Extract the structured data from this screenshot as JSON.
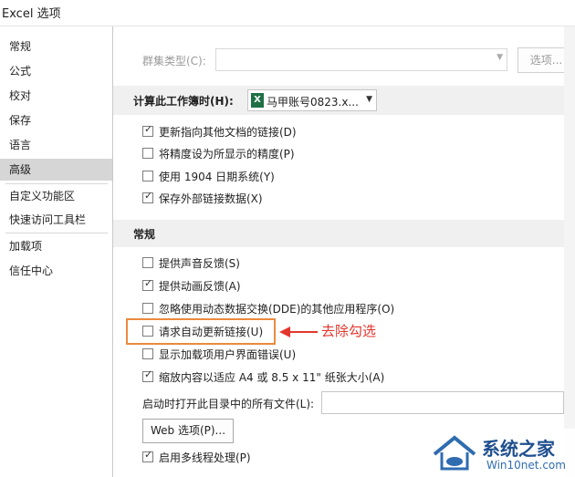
{
  "window": {
    "title": "Excel 选项"
  },
  "sidebar": {
    "items": [
      {
        "label": "常规"
      },
      {
        "label": "公式"
      },
      {
        "label": "校对"
      },
      {
        "label": "保存"
      },
      {
        "label": "语言"
      },
      {
        "label": "高级",
        "active": true
      },
      {
        "label": "自定义功能区"
      },
      {
        "label": "快速访问工具栏"
      },
      {
        "label": "加载项"
      },
      {
        "label": "信任中心"
      }
    ]
  },
  "cluster": {
    "label": "群集类型(C):",
    "value": "",
    "options_button": "选项..."
  },
  "calc_section": {
    "title": "计算此工作簿时(H):",
    "workbook": "马甲账号0823.x...",
    "options": [
      {
        "label": "更新指向其他文档的链接(D)",
        "checked": true
      },
      {
        "label": "将精度设为所显示的精度(P)",
        "checked": false
      },
      {
        "label": "使用 1904 日期系统(Y)",
        "checked": false
      },
      {
        "label": "保存外部链接数据(X)",
        "checked": true
      }
    ]
  },
  "general_section": {
    "title": "常规",
    "options": [
      {
        "label": "提供声音反馈(S)",
        "checked": false
      },
      {
        "label": "提供动画反馈(A)",
        "checked": true
      },
      {
        "label": "忽略使用动态数据交换(DDE)的其他应用程序(O)",
        "checked": false
      },
      {
        "label": "请求自动更新链接(U)",
        "checked": false
      },
      {
        "label": "显示加载项用户界面错误(U)",
        "checked": false
      },
      {
        "label": "缩放内容以适应 A4 或 8.5 x 11\" 纸张大小(A)",
        "checked": true
      }
    ],
    "startup_label": "启动时打开此目录中的所有文件(L):",
    "startup_value": "",
    "web_options_button": "Web 选项(P)...",
    "multithread": {
      "label": "启用多线程处理(P)",
      "checked": true
    }
  },
  "annotation": {
    "text": "去除勾选",
    "color": "#e3362d"
  },
  "watermark": {
    "brand": "系统之家",
    "url": "Win10net.com"
  },
  "colors": {
    "highlight": "#e98b3f",
    "sidebar_active": "#d6d6d6",
    "section_stripe": "#f0f0f0"
  }
}
